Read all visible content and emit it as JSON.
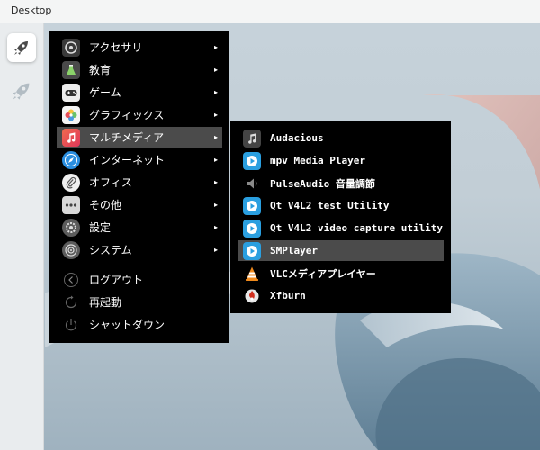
{
  "panel": {
    "title": "Desktop"
  },
  "dock": {
    "items": [
      {
        "icon": "rocket-launcher-icon",
        "active": true
      },
      {
        "icon": "rocket-icon",
        "active": false
      }
    ]
  },
  "main_menu": {
    "categories": [
      {
        "label": "アクセサリ",
        "icon": "accessories-icon",
        "arrow": "▸"
      },
      {
        "label": "教育",
        "icon": "education-icon",
        "arrow": "▸"
      },
      {
        "label": "ゲーム",
        "icon": "gamepad-icon",
        "arrow": "▸"
      },
      {
        "label": "グラフィックス",
        "icon": "graphics-icon",
        "arrow": "▸"
      },
      {
        "label": "マルチメディア",
        "icon": "music-icon",
        "arrow": "▸"
      },
      {
        "label": "インターネット",
        "icon": "compass-icon",
        "arrow": "▸"
      },
      {
        "label": "オフィス",
        "icon": "paperclip-icon",
        "arrow": "▸"
      },
      {
        "label": "その他",
        "icon": "more-icon",
        "arrow": "▸"
      },
      {
        "label": "設定",
        "icon": "settings-icon",
        "arrow": "▸"
      },
      {
        "label": "システム",
        "icon": "system-icon",
        "arrow": "▸"
      }
    ],
    "actions": [
      {
        "label": "ログアウト",
        "icon": "logout-icon"
      },
      {
        "label": "再起動",
        "icon": "restart-icon"
      },
      {
        "label": "シャットダウン",
        "icon": "power-icon"
      }
    ],
    "highlighted": "マルチメディア"
  },
  "sub_menu": {
    "items": [
      {
        "label": "Audacious",
        "icon": "audacious-icon"
      },
      {
        "label": "mpv Media Player",
        "icon": "play-icon"
      },
      {
        "label": "PulseAudio 音量調節",
        "icon": "speaker-icon"
      },
      {
        "label": "Qt V4L2 test Utility",
        "icon": "play-icon"
      },
      {
        "label": "Qt V4L2 video capture utility",
        "icon": "play-icon"
      },
      {
        "label": "SMPlayer",
        "icon": "play-icon"
      },
      {
        "label": "VLCメディアプレイヤー",
        "icon": "vlc-cone-icon"
      },
      {
        "label": "Xfburn",
        "icon": "xfburn-icon"
      }
    ],
    "highlighted": "SMPlayer"
  },
  "colors": {
    "menu_bg": "#000000",
    "highlight": "#4b4b4b",
    "play_blue": "#2a9fe0",
    "multimedia_red": "#e8443f",
    "vlc_orange": "#f08a1c"
  }
}
